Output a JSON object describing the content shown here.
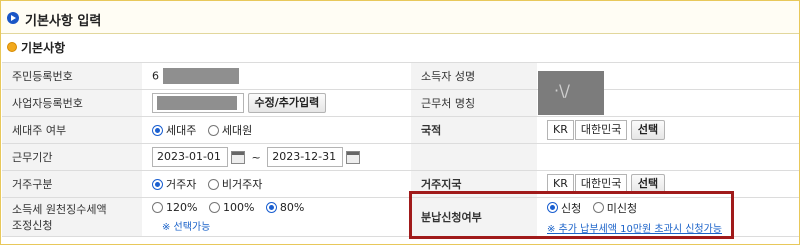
{
  "header": {
    "title": "기본사항 입력"
  },
  "section": {
    "title": "기본사항"
  },
  "rows": {
    "ssn": {
      "label": "주민등록번호",
      "value_prefix": "6"
    },
    "bizno": {
      "label": "사업자등록번호",
      "button": "수정/추가입력"
    },
    "householder": {
      "label": "세대주 여부",
      "options": [
        "세대주",
        "세대원"
      ],
      "selected": "세대주"
    },
    "period": {
      "label": "근무기간",
      "start": "2023-01-01",
      "sep": "~",
      "end": "2023-12-31"
    },
    "residence": {
      "label": "거주구분",
      "options": [
        "거주자",
        "비거주자"
      ],
      "selected": "거주자"
    },
    "withholding": {
      "label_line1": "소득세 원천징수세액",
      "label_line2": "조정신청",
      "options": [
        "120%",
        "100%",
        "80%"
      ],
      "selected": "80%",
      "note": "※ 선택가능"
    }
  },
  "right": {
    "earner_name": {
      "label": "소득자 성명"
    },
    "workplace": {
      "label": "근무처 명칭"
    },
    "nationality": {
      "label": "국적",
      "code": "KR",
      "name": "대한민국",
      "button": "선택"
    },
    "residence_country": {
      "label": "거주지국",
      "code": "KR",
      "name": "대한민국",
      "button": "선택"
    },
    "installment": {
      "label": "분납신청여부",
      "options": [
        "신청",
        "미신청"
      ],
      "selected": "신청",
      "note": "※ 추가 납부세액 10만원 초과시 신청가능"
    }
  },
  "colors": {
    "accent": "#1a56c6",
    "highlight": "#a01a1a",
    "note": "#1a62c9"
  }
}
